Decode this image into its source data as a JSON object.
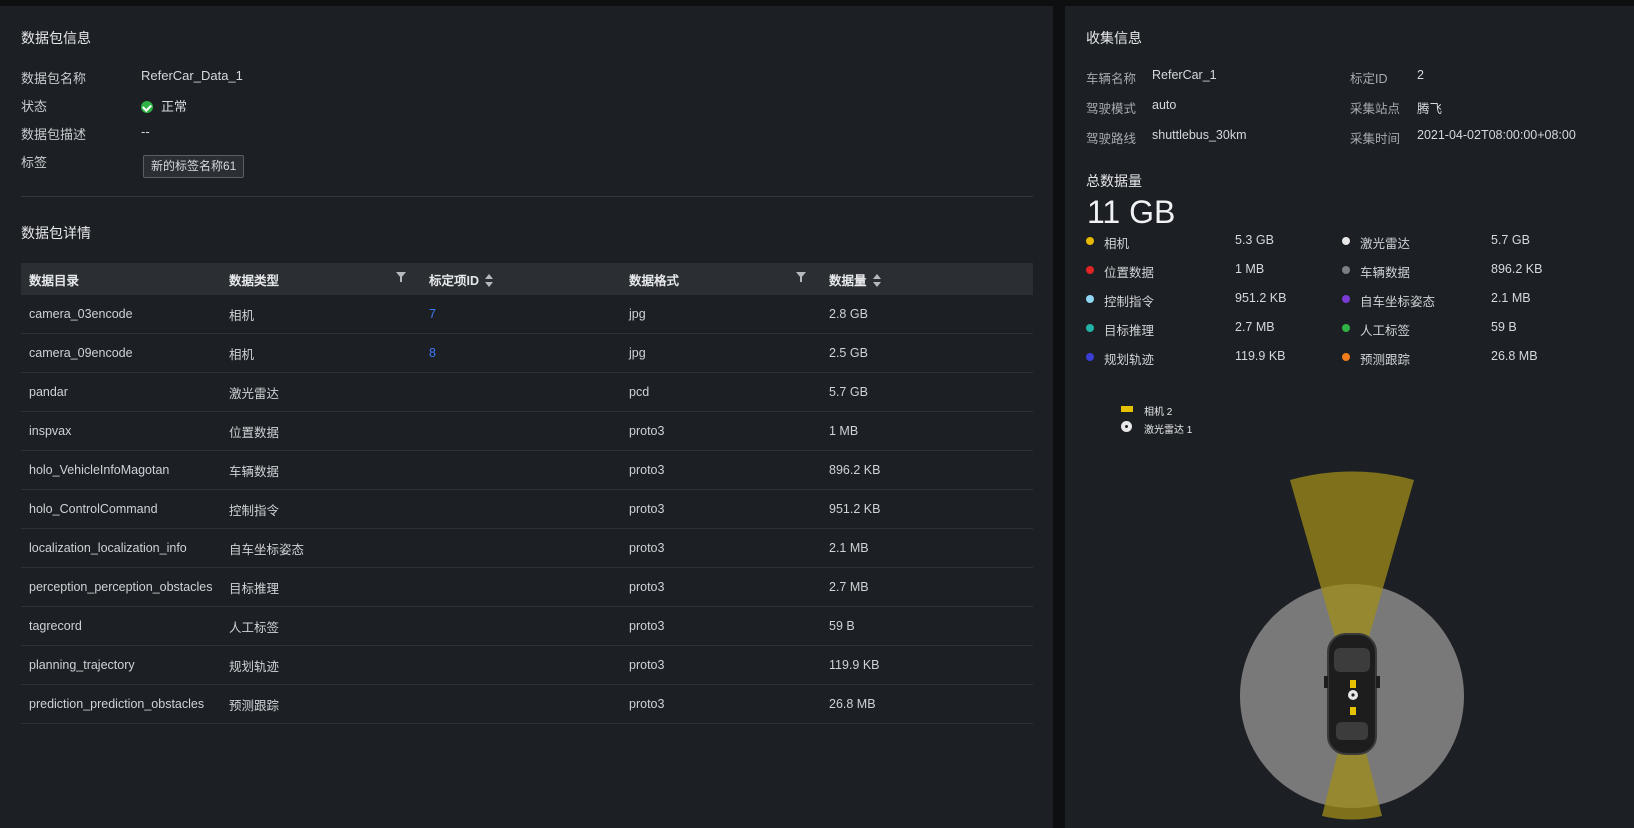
{
  "package_info": {
    "title": "数据包信息",
    "name_label": "数据包名称",
    "name_value": "ReferCar_Data_1",
    "status_label": "状态",
    "status_value": "正常",
    "desc_label": "数据包描述",
    "desc_value": "--",
    "tags_label": "标签",
    "tag_value": "新的标签名称61"
  },
  "details": {
    "title": "数据包详情",
    "columns": [
      "数据目录",
      "数据类型",
      "标定项ID",
      "数据格式",
      "数据量"
    ],
    "rows": [
      {
        "dir": "camera_03encode",
        "type": "相机",
        "calib_id": "7",
        "format": "jpg",
        "size": "2.8 GB"
      },
      {
        "dir": "camera_09encode",
        "type": "相机",
        "calib_id": "8",
        "format": "jpg",
        "size": "2.5 GB"
      },
      {
        "dir": "pandar",
        "type": "激光雷达",
        "calib_id": "",
        "format": "pcd",
        "size": "5.7 GB"
      },
      {
        "dir": "inspvax",
        "type": "位置数据",
        "calib_id": "",
        "format": "proto3",
        "size": "1 MB"
      },
      {
        "dir": "holo_VehicleInfoMagotan",
        "type": "车辆数据",
        "calib_id": "",
        "format": "proto3",
        "size": "896.2 KB"
      },
      {
        "dir": "holo_ControlCommand",
        "type": "控制指令",
        "calib_id": "",
        "format": "proto3",
        "size": "951.2 KB"
      },
      {
        "dir": "localization_localization_info",
        "type": "自车坐标姿态",
        "calib_id": "",
        "format": "proto3",
        "size": "2.1 MB"
      },
      {
        "dir": "perception_perception_obstacles",
        "type": "目标推理",
        "calib_id": "",
        "format": "proto3",
        "size": "2.7 MB"
      },
      {
        "dir": "tagrecord",
        "type": "人工标签",
        "calib_id": "",
        "format": "proto3",
        "size": "59 B"
      },
      {
        "dir": "planning_trajectory",
        "type": "规划轨迹",
        "calib_id": "",
        "format": "proto3",
        "size": "119.9 KB"
      },
      {
        "dir": "prediction_prediction_obstacles",
        "type": "预测跟踪",
        "calib_id": "",
        "format": "proto3",
        "size": "26.8 MB"
      }
    ]
  },
  "collection": {
    "title": "收集信息",
    "vehicle_label": "车辆名称",
    "vehicle_value": "ReferCar_1",
    "calib_label": "标定ID",
    "calib_value": "2",
    "mode_label": "驾驶模式",
    "mode_value": "auto",
    "site_label": "采集站点",
    "site_value": "腾飞",
    "route_label": "驾驶路线",
    "route_value": "shuttlebus_30km",
    "time_label": "采集时间",
    "time_value": "2021-04-02T08:00:00+08:00"
  },
  "total": {
    "label": "总数据量",
    "value": "11 GB"
  },
  "breakdown": [
    {
      "name": "相机",
      "value": "5.3 GB",
      "color": "#e6b800"
    },
    {
      "name": "激光雷达",
      "value": "5.7 GB",
      "color": "#e8e8e8"
    },
    {
      "name": "位置数据",
      "value": "1 MB",
      "color": "#e02424"
    },
    {
      "name": "车辆数据",
      "value": "896.2 KB",
      "color": "#7b7f85"
    },
    {
      "name": "控制指令",
      "value": "951.2 KB",
      "color": "#8fd6f5"
    },
    {
      "name": "自车坐标姿态",
      "value": "2.1 MB",
      "color": "#7a3ad6"
    },
    {
      "name": "目标推理",
      "value": "2.7 MB",
      "color": "#21b3a8"
    },
    {
      "name": "人工标签",
      "value": "59 B",
      "color": "#2fb344"
    },
    {
      "name": "规划轨迹",
      "value": "119.9 KB",
      "color": "#3b3fd6"
    },
    {
      "name": "预测跟踪",
      "value": "26.8 MB",
      "color": "#f07d1a"
    }
  ],
  "sensor_legend": {
    "camera": "相机 2",
    "lidar": "激光雷达 1"
  },
  "colors": {
    "accent": "#3e7bfa",
    "camera_fov": "#a08d1a",
    "lidar_range": "#a8a8a8",
    "status_ok": "#2fb344"
  }
}
